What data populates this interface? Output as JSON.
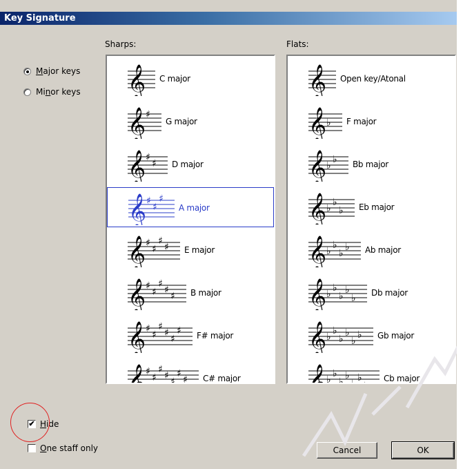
{
  "dialog": {
    "title": "Key Signature",
    "sharps_label": "Sharps:",
    "flats_label": "Flats:"
  },
  "mode": {
    "major_label_u": "M",
    "major_label_rest": "ajor keys",
    "minor_label_pre": "Mi",
    "minor_label_u": "n",
    "minor_label_rest": "or keys",
    "selected": "major"
  },
  "sharps": [
    {
      "label": "C major",
      "count": 0
    },
    {
      "label": "G major",
      "count": 1
    },
    {
      "label": "D major",
      "count": 2
    },
    {
      "label": "A major",
      "count": 3,
      "selected": true
    },
    {
      "label": "E major",
      "count": 4
    },
    {
      "label": "B major",
      "count": 5
    },
    {
      "label": "F# major",
      "count": 6
    },
    {
      "label": "C# major",
      "count": 7
    }
  ],
  "flats": [
    {
      "label": "Open key/Atonal",
      "count": 0
    },
    {
      "label": "F major",
      "count": 1
    },
    {
      "label": "Bb major",
      "count": 2
    },
    {
      "label": "Eb major",
      "count": 3
    },
    {
      "label": "Ab major",
      "count": 4
    },
    {
      "label": "Db major",
      "count": 5
    },
    {
      "label": "Gb major",
      "count": 6
    },
    {
      "label": "Cb major",
      "count": 7
    }
  ],
  "options": {
    "hide_u": "H",
    "hide_rest": "ide",
    "hide_checked": true,
    "one_staff_u": "O",
    "one_staff_rest": "ne staff only",
    "one_staff_checked": false
  },
  "buttons": {
    "cancel": "Cancel",
    "ok": "OK"
  },
  "colors": {
    "selection": "#2a3cc8",
    "annotation_circle": "#e02020"
  }
}
